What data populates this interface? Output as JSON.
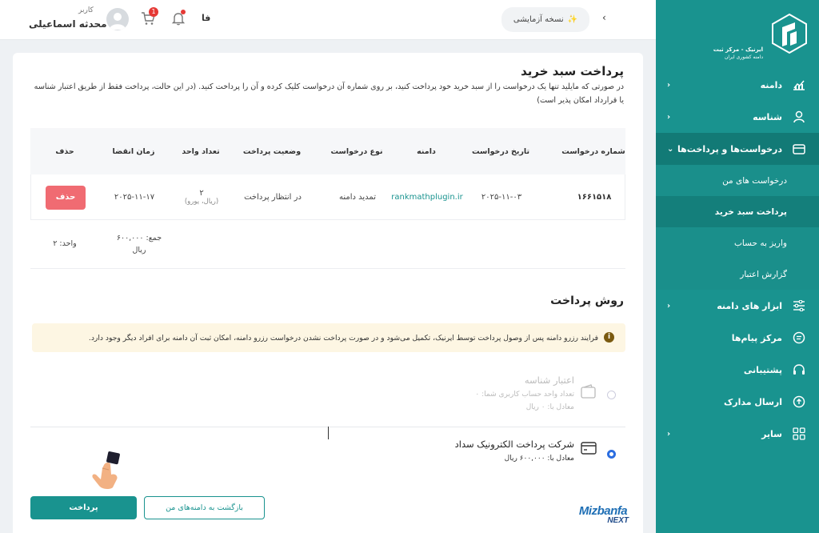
{
  "sidebar": {
    "logo_text_main": "ایرنیک - مرکز ثبت",
    "logo_text_sub": "دامنه کشوری ایران",
    "items": [
      {
        "label": "دامنه",
        "icon": "chart-icon"
      },
      {
        "label": "شناسه",
        "icon": "user-icon"
      },
      {
        "label": "درخواست‌ها و پرداخت‌ها",
        "icon": "card-icon"
      },
      {
        "label": "ابزار های دامنه",
        "icon": "sliders-icon"
      },
      {
        "label": "مرکز پیام‌ها",
        "icon": "message-icon"
      },
      {
        "label": "پشتیبانی",
        "icon": "headset-icon"
      },
      {
        "label": "ارسال مدارک",
        "icon": "upload-icon"
      },
      {
        "label": "سایر",
        "icon": "grid-icon"
      }
    ],
    "subitems": [
      {
        "label": "درخواست های من"
      },
      {
        "label": "پرداخت سبد خرید"
      },
      {
        "label": "واریز به حساب"
      },
      {
        "label": "گزارش اعتبار"
      }
    ]
  },
  "header": {
    "trial_label": "نسخه آزمایشی",
    "lang": "فا",
    "cart_count": "1",
    "user_role": "کاربر",
    "user_name": "محدثه اسماعیلی"
  },
  "page": {
    "title": "پرداخت سبد خرید",
    "description": "در صورتی که مایلید تنها یک درخواست را از سبد خرید خود پرداخت کنید، بر روی شماره آن درخواست کلیک کرده و آن را پرداخت کنید. (در این حالت، پرداخت فقط از طریق اعتبار شناسه یا قرارداد امکان پذیر است)"
  },
  "table": {
    "headers": {
      "number": "شماره درخواست",
      "date": "تاریخ درخواست",
      "domain": "دامنه",
      "type": "نوع درخواست",
      "status": "وضعیت پرداخت",
      "units": "تعداد واحد",
      "expiry": "زمان انقضا",
      "delete": "حذف"
    },
    "row": {
      "number": "۱۶۶۱۵۱۸",
      "date": "۲۰۲۵-۱۱-۰۳",
      "domain": "rankmathplugin.ir",
      "type": "تمدید دامنه",
      "status": "در انتظار پرداخت",
      "units": "۲",
      "units_sub": "(ریال، یورو)",
      "expiry": "۲۰۲۵-۱۱-۱۷",
      "delete_label": "حذف"
    },
    "summary": {
      "total_label": "جمع: ۶۰۰,۰۰۰",
      "total_currency": "ریال",
      "units_label": "واحد: ۲"
    }
  },
  "payment": {
    "title": "روش پرداخت",
    "alert": "فرایند رزرو دامنه پس از وصول پرداخت توسط ایرنیک، تکمیل می‌شود و در صورت پرداخت نشدن درخواست رزرو دامنه، امکان ثبت آن دامنه برای افراد دیگر وجود دارد.",
    "option1": {
      "title": "اعتبار شناسه",
      "line1": "تعداد واحد حساب کاربری شما: ۰",
      "line2": "معادل با: ۰ ریال"
    },
    "option2": {
      "title": "شرکت پرداخت الکترونیک سداد",
      "line1": "معادل با:  ۶۰۰,۰۰۰ ریال"
    },
    "pay_button": "پرداخت",
    "back_button": "بازگشت به دامنه‌های من",
    "watermark_top": "Mizbanfa",
    "watermark_bottom": "NEXT"
  },
  "colors": {
    "sidebar": "#19938f",
    "accent": "#19938f",
    "danger": "#f06b72",
    "alert_bg": "#fdf6e3"
  }
}
